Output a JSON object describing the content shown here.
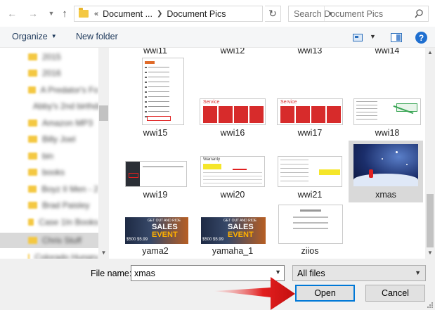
{
  "address": {
    "overflow": "«",
    "crumbs": [
      "Document ...",
      "Document Pics"
    ]
  },
  "search": {
    "placeholder": "Search Document Pics"
  },
  "toolbar": {
    "organize": "Organize",
    "new_folder": "New folder",
    "help": "?"
  },
  "nav_items": [
    "2015",
    "2016",
    "A Predator's Fo",
    "Abby's 2nd birthday",
    "Amazon MP3",
    "Billy Joel",
    "bin",
    "books",
    "Boyz II Men - 2",
    "Brad Paisley",
    "Case 1In Books",
    "Chris Stuff",
    "Colorado Hungry"
  ],
  "files": {
    "top_row_cut": [
      "wwi11",
      "wwi12",
      "wwi13",
      "wwi14"
    ],
    "row1": [
      "wwi15",
      "wwi16",
      "wwi17",
      "wwi18"
    ],
    "row2": [
      "wwi19",
      "wwi20",
      "wwi21",
      "xmas"
    ],
    "row3": [
      "yama2",
      "yamaha_1",
      "ziios"
    ],
    "thumb_texts": {
      "service": "Service",
      "warranty": "Warranty",
      "sales_line1": "GET OUT AND RIDE",
      "sales_line2": "SALES",
      "sales_line3": "EVENT",
      "sales_price": "$500 $5.99"
    }
  },
  "bottom": {
    "file_name_label": "File name:",
    "file_name_value": "xmas",
    "filter_value": "All files",
    "open": "Open",
    "cancel": "Cancel"
  },
  "colors": {
    "service_red": "#d72b2b",
    "selection_gray": "#d9d9d9",
    "open_border": "#0078d7",
    "arrow_red": "#e21f1f"
  }
}
